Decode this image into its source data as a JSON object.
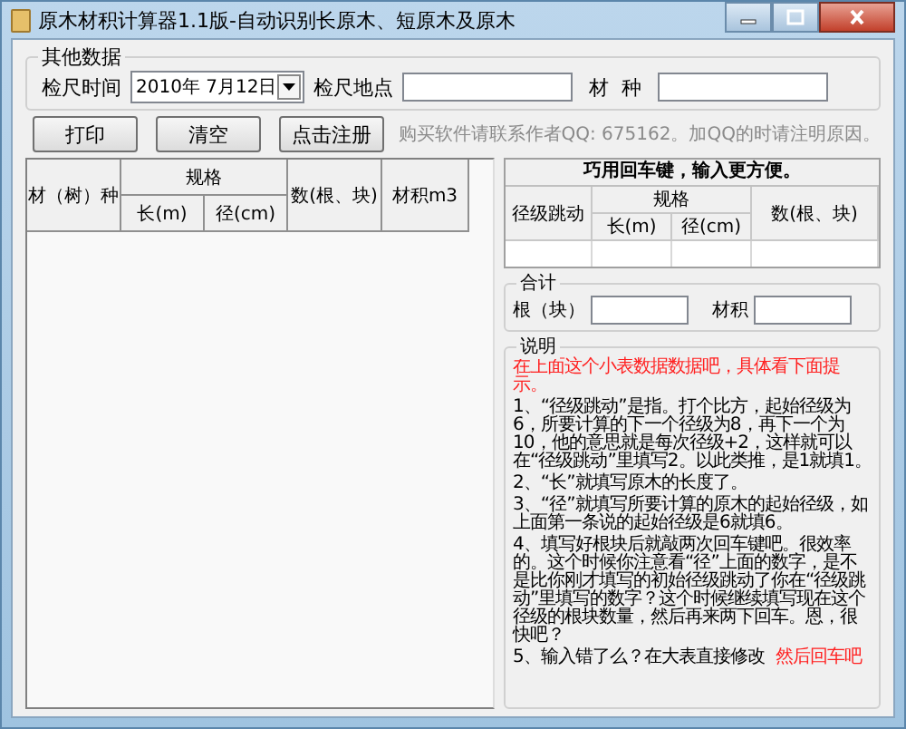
{
  "window": {
    "title": "原木材积计算器1.1版-自动识别长原木、短原木及原木"
  },
  "other_data": {
    "legend": "其他数据",
    "date_label": "检尺时间",
    "date_value": "2010年 7月12日",
    "place_label": "检尺地点",
    "species_label": "材  种"
  },
  "buttons": [
    {
      "label": "打印"
    },
    {
      "label": "清空"
    },
    {
      "label": "点击注册"
    }
  ],
  "notice": "购买软件请联系作者QQ: 675162。加QQ的时请注明原因。",
  "main_table": {
    "columns": [
      {
        "label": "材（树）种"
      },
      {
        "label": "规格",
        "children": [
          "长(m)",
          "径(cm)"
        ]
      },
      {
        "label": "数(根、块)"
      },
      {
        "label": "材积m3"
      }
    ]
  },
  "entry_table": {
    "title": "巧用回车键，输入更方便。",
    "columns": [
      {
        "label": "径级跳动"
      },
      {
        "label": "规格",
        "children": [
          "长(m)",
          "径(cm)"
        ]
      },
      {
        "label": "数(根、块)"
      }
    ]
  },
  "totals": {
    "legend": "合计",
    "count_label": "根（块）",
    "volume_label": "材积"
  },
  "help": {
    "legend": "说明",
    "intro": "在上面这个小表数据数据吧，具体看下面提示。",
    "items": [
      {
        "text": "1、“径级跳动”是指。打个比方，起始径级为6，所要计算的下一个径级为8，再下一个为10，他的意思就是每次径级+2，这样就可以在“径级跳动”里填写2。以此类推，是1就填1。"
      },
      {
        "text": "2、“长”就填写原木的长度了。"
      },
      {
        "text": "3、“径”就填写所要计算的原木的起始径级，如上面第一条说的起始径级是6就填6。"
      },
      {
        "text": "4、填写好根块后就敲两次回车键吧。很效率的。这个时候你注意看“径”上面的数字，是不是比你刚才填写的初始径级跳动了你在“径级跳动”里填写的数字？这个时候继续填写现在这个径级的根块数量，然后再来两下回车。恩，很快吧？"
      },
      {
        "text": "5、输入错了么？在大表直接修改",
        "note": "然后回车吧"
      }
    ]
  }
}
